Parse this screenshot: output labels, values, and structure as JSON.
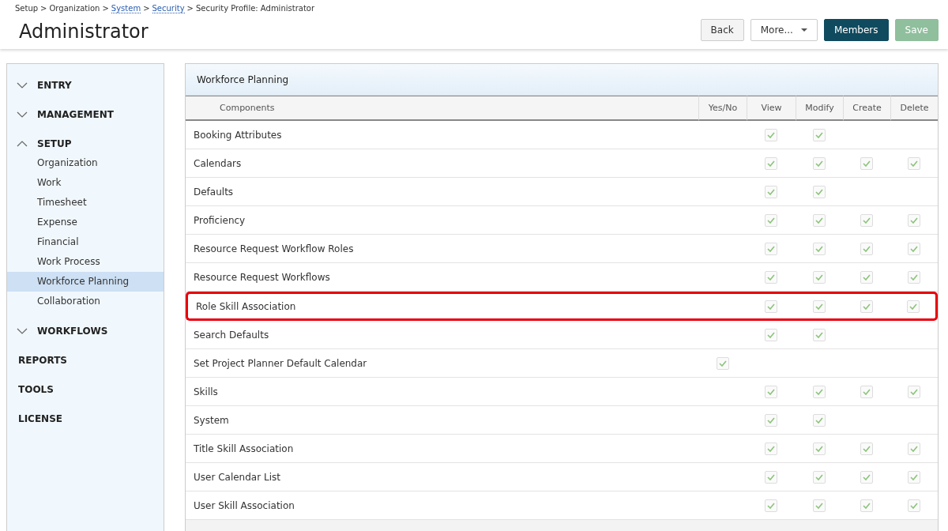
{
  "breadcrumb": {
    "separator": ">",
    "items": [
      {
        "label": "Setup",
        "link": false
      },
      {
        "label": "Organization",
        "link": false
      },
      {
        "label": "System",
        "link": true
      },
      {
        "label": "Security",
        "link": true
      },
      {
        "label": "Security Profile: Administrator",
        "link": false
      }
    ]
  },
  "title": "Administrator",
  "buttons": [
    {
      "label": "Back",
      "kind": "default"
    },
    {
      "label": "More...",
      "kind": "dropdown"
    },
    {
      "label": "Members",
      "kind": "primary"
    },
    {
      "label": "Save",
      "kind": "primary",
      "disabled": true
    }
  ],
  "sidebar": [
    {
      "label": "ENTRY",
      "kind": "group",
      "expanded": false
    },
    {
      "label": "MANAGEMENT",
      "kind": "group",
      "expanded": false
    },
    {
      "label": "SETUP",
      "kind": "group",
      "expanded": true,
      "children": [
        {
          "label": "Organization",
          "selected": false
        },
        {
          "label": "Work",
          "selected": false
        },
        {
          "label": "Timesheet",
          "selected": false
        },
        {
          "label": "Expense",
          "selected": false
        },
        {
          "label": "Financial",
          "selected": false
        },
        {
          "label": "Work Process",
          "selected": false
        },
        {
          "label": "Workforce Planning",
          "selected": true
        },
        {
          "label": "Collaboration",
          "selected": false
        }
      ]
    },
    {
      "label": "WORKFLOWS",
      "kind": "group",
      "expanded": false
    },
    {
      "label": "REPORTS",
      "kind": "link"
    },
    {
      "label": "TOOLS",
      "kind": "link"
    },
    {
      "label": "LICENSE",
      "kind": "link"
    }
  ],
  "panel": {
    "title": "Workforce Planning",
    "columns": [
      "Components",
      "Yes/No",
      "View",
      "Modify",
      "Create",
      "Delete"
    ],
    "rows": [
      {
        "name": "Booking Attributes",
        "highlighted": false,
        "checks": [
          false,
          true,
          true,
          false,
          false
        ]
      },
      {
        "name": "Calendars",
        "highlighted": false,
        "checks": [
          false,
          true,
          true,
          true,
          true
        ]
      },
      {
        "name": "Defaults",
        "highlighted": false,
        "checks": [
          false,
          true,
          true,
          false,
          false
        ]
      },
      {
        "name": "Proficiency",
        "highlighted": false,
        "checks": [
          false,
          true,
          true,
          true,
          true
        ]
      },
      {
        "name": "Resource Request Workflow Roles",
        "highlighted": false,
        "checks": [
          false,
          true,
          true,
          true,
          true
        ]
      },
      {
        "name": "Resource Request Workflows",
        "highlighted": false,
        "checks": [
          false,
          true,
          true,
          true,
          true
        ]
      },
      {
        "name": "Role Skill Association",
        "highlighted": true,
        "checks": [
          false,
          true,
          true,
          true,
          true
        ]
      },
      {
        "name": "Search Defaults",
        "highlighted": false,
        "checks": [
          false,
          true,
          true,
          false,
          false
        ]
      },
      {
        "name": "Set Project Planner Default Calendar",
        "highlighted": false,
        "checks": [
          true,
          false,
          false,
          false,
          false
        ]
      },
      {
        "name": "Skills",
        "highlighted": false,
        "checks": [
          false,
          true,
          true,
          true,
          true
        ]
      },
      {
        "name": "System",
        "highlighted": false,
        "checks": [
          false,
          true,
          true,
          false,
          false
        ]
      },
      {
        "name": "Title Skill Association",
        "highlighted": false,
        "checks": [
          false,
          true,
          true,
          true,
          true
        ]
      },
      {
        "name": "User Calendar List",
        "highlighted": false,
        "checks": [
          false,
          true,
          true,
          true,
          true
        ]
      },
      {
        "name": "User Skill Association",
        "highlighted": false,
        "checks": [
          false,
          true,
          true,
          true,
          true
        ]
      }
    ]
  }
}
